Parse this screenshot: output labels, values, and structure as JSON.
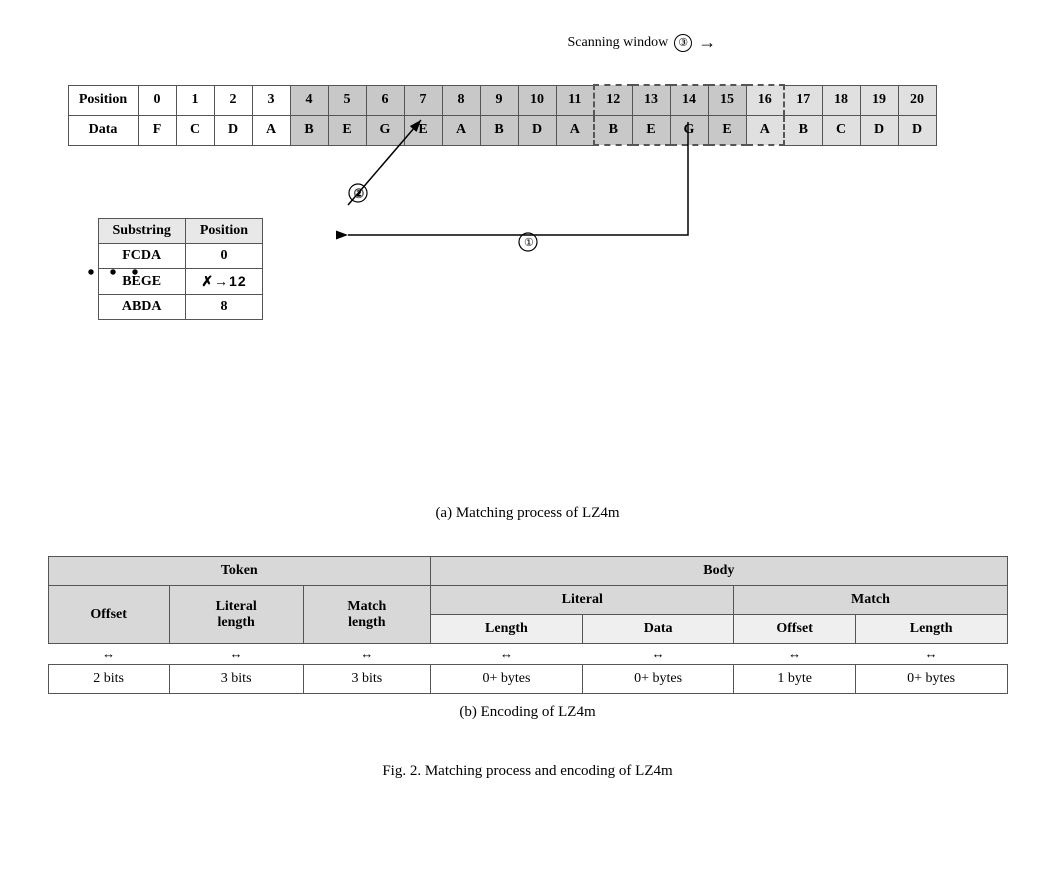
{
  "partA": {
    "scanningLabel": "Scanning window",
    "circleNums": [
      "③",
      "②",
      "①"
    ],
    "positions": [
      "Position",
      "0",
      "1",
      "2",
      "3",
      "4",
      "5",
      "6",
      "7",
      "8",
      "9",
      "10",
      "11",
      "12",
      "13",
      "14",
      "15",
      "16",
      "17",
      "18",
      "19",
      "20"
    ],
    "data": [
      "Data",
      "F",
      "C",
      "D",
      "A",
      "B",
      "E",
      "G",
      "E",
      "A",
      "B",
      "D",
      "A",
      "B",
      "E",
      "G",
      "E",
      "A",
      "B",
      "C",
      "D",
      "D"
    ],
    "substringTable": {
      "headers": [
        "Substring",
        "Position"
      ],
      "rows": [
        [
          "FCDA",
          "0"
        ],
        [
          "BEGE",
          "✗→12"
        ],
        [
          "ABDA",
          "8"
        ]
      ]
    },
    "dots": "• • •",
    "caption": "(a)  Matching process of LZ4m"
  },
  "partB": {
    "caption": "(b)  Encoding of LZ4m",
    "headers": {
      "token": "Token",
      "body": "Body"
    },
    "subheaders": {
      "offset": "Offset",
      "literalLength": "Literal\nlength",
      "matchLength": "Match\nlength",
      "literal": "Literal",
      "match": "Match"
    },
    "subsubheaders": {
      "litLength": "Length",
      "litData": "Data",
      "matchOffset": "Offset",
      "matchLength": "Length"
    },
    "values": {
      "offset": "2 bits",
      "litLen": "3 bits",
      "matchLen": "3 bits",
      "litLength": "0+ bytes",
      "litData": "0+ bytes",
      "matchOffset": "1 byte",
      "matchLength": "0+ bytes"
    }
  },
  "figCaption": "Fig. 2.   Matching process and encoding of LZ4m"
}
